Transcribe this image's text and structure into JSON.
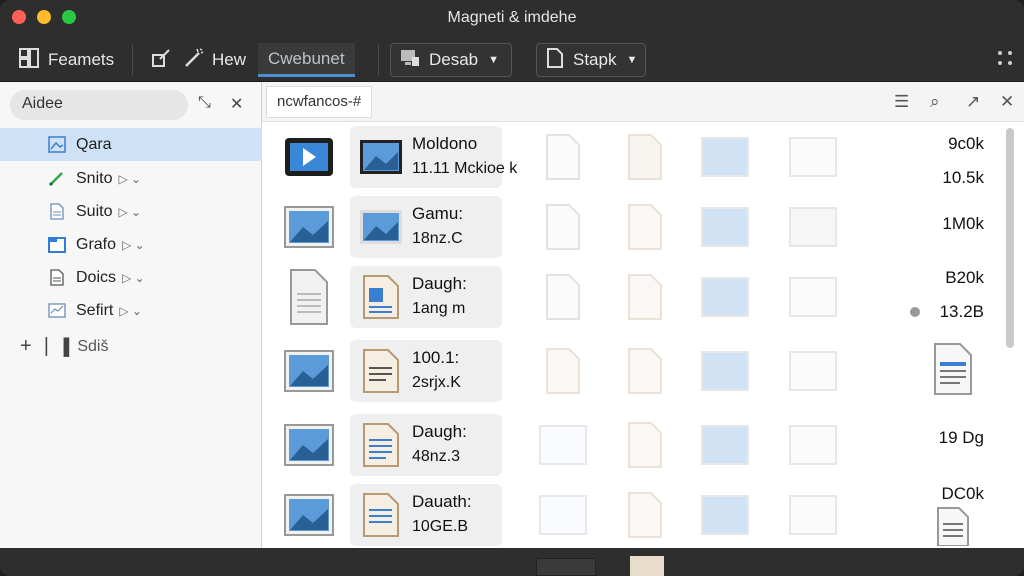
{
  "window": {
    "title": "Magneti & imdehe"
  },
  "toolbar": {
    "formats_label": "Feamets",
    "new_label": "Hew",
    "active_tab_label": "Cwebunet",
    "desktop_label": "Desab",
    "share_label": "Stapk"
  },
  "sidebar": {
    "search_text": "Aidee",
    "items": [
      {
        "label": "Qara",
        "icon": "image-icon",
        "selected": true
      },
      {
        "label": "Snito",
        "icon": "pen-icon",
        "selected": false
      },
      {
        "label": "Suito",
        "icon": "document-icon",
        "selected": false
      },
      {
        "label": "Grafo",
        "icon": "folder-icon",
        "selected": false
      },
      {
        "label": "Doics",
        "icon": "document-icon",
        "selected": false
      },
      {
        "label": "Sefirt",
        "icon": "chart-icon",
        "selected": false
      }
    ],
    "add_label": "Sdiš"
  },
  "content": {
    "path_tab": "ncwfancos-#",
    "files": [
      {
        "name": "Moldono",
        "meta": "11.11 Mckioe k",
        "size": "9c0k",
        "type": "video"
      },
      {
        "name": "Gamu:",
        "meta": "18nz.C",
        "size": "1M0k",
        "type": "image"
      },
      {
        "name": "Daugh:",
        "meta": "1ang m",
        "size": "B20k",
        "type": "document"
      },
      {
        "name": "100.1:",
        "meta": "2srjx.K",
        "size": "",
        "type": "image"
      },
      {
        "name": "Daugh:",
        "meta": "48nz.3",
        "size": "19 Dg",
        "type": "image"
      },
      {
        "name": "Dauath:",
        "meta": "10GE.B",
        "size": "DC0k",
        "type": "image"
      }
    ],
    "extra_sizes": [
      "10.5k",
      "13.2B"
    ]
  },
  "colors": {
    "accent": "#4a8fd6",
    "selected_bg": "#cfe1f5"
  }
}
